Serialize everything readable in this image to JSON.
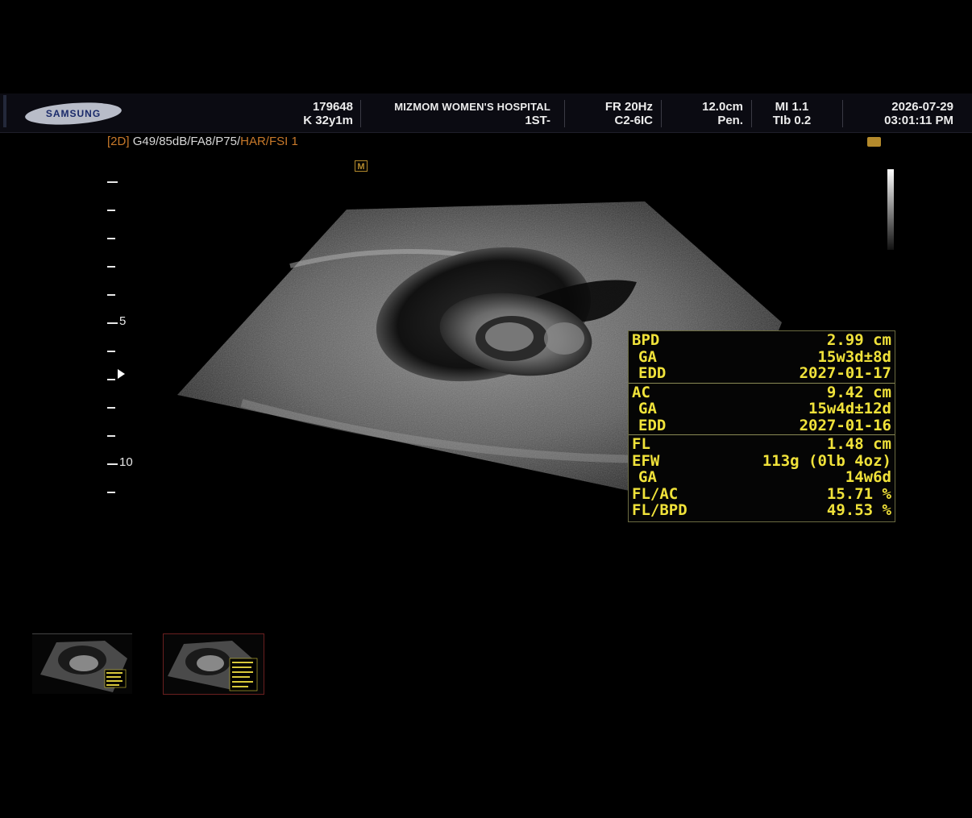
{
  "header": {
    "brand": "SAMSUNG",
    "patient_id": "179648",
    "patient_info": "K 32y1m",
    "hospital": "MIZMOM WOMEN'S HOSPITAL",
    "hospital_sub": "1ST-",
    "frame_rate": "FR 20Hz",
    "probe": "C2-6IC",
    "depth": "12.0cm",
    "preset": "Pen.",
    "mi": "MI 1.1",
    "tib": "TIb 0.2",
    "date": "2026-07-29",
    "time": "03:01:11 PM"
  },
  "mode": {
    "mode_tag": "[2D]",
    "params": "G49/85dB/FA8/P75/",
    "har_fsi": "HAR/FSI 1",
    "m_icon": "M"
  },
  "depth_scale": {
    "labels": [
      "5",
      "10"
    ]
  },
  "measurements": {
    "groups": [
      [
        {
          "key": "BPD",
          "value": "2.99 cm",
          "sub": false
        },
        {
          "key": "GA",
          "value": "15w3d±8d",
          "sub": true
        },
        {
          "key": "EDD",
          "value": "2027-01-17",
          "sub": true
        }
      ],
      [
        {
          "key": "AC",
          "value": "9.42 cm",
          "sub": false
        },
        {
          "key": "GA",
          "value": "15w4d±12d",
          "sub": true
        },
        {
          "key": "EDD",
          "value": "2027-01-16",
          "sub": true
        }
      ],
      [
        {
          "key": "FL",
          "value": "1.48 cm",
          "sub": false
        },
        {
          "key": "EFW",
          "value": "113g (0lb 4oz)",
          "sub": false
        },
        {
          "key": "GA",
          "value": "14w6d",
          "sub": true
        },
        {
          "key": "FL/AC",
          "value": "15.71 %",
          "sub": false
        },
        {
          "key": "FL/BPD",
          "value": "49.53 %",
          "sub": false
        }
      ]
    ]
  },
  "colors": {
    "measure_text": "#f0e23a",
    "accent_orange": "#c8792a"
  }
}
